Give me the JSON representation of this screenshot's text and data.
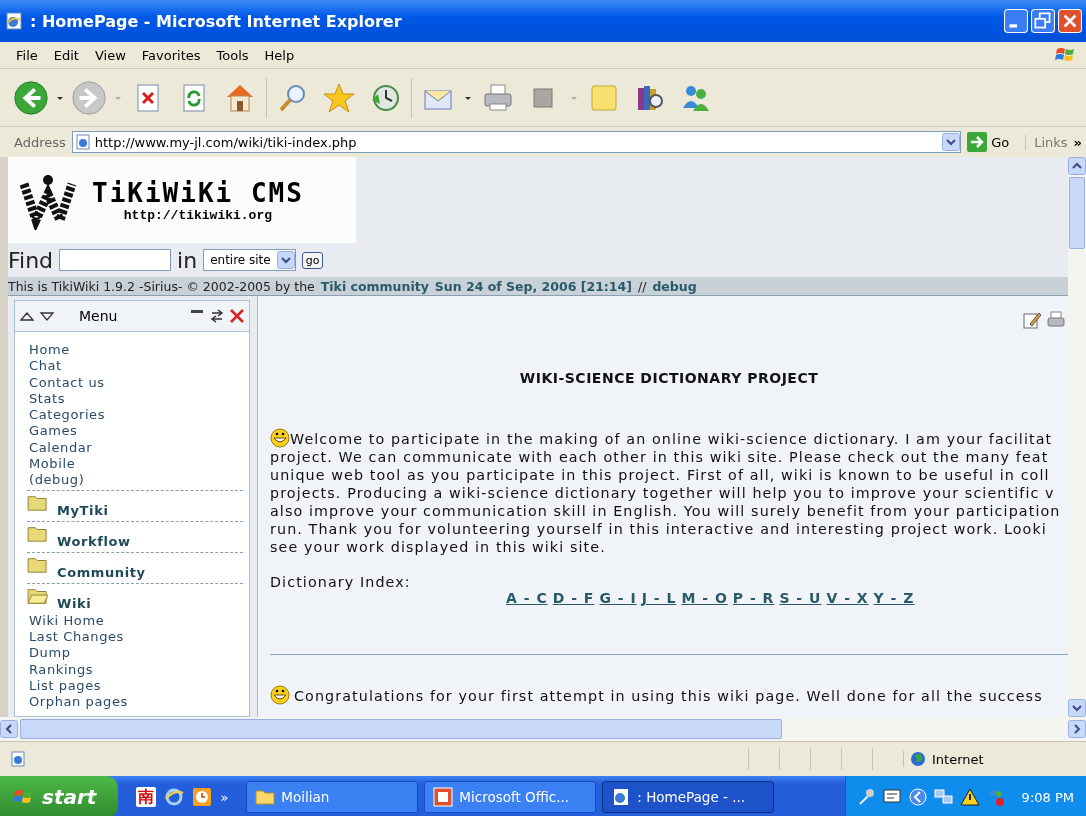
{
  "window": {
    "title": ": HomePage - Microsoft Internet Explorer"
  },
  "menu_bar": [
    "File",
    "Edit",
    "View",
    "Favorites",
    "Tools",
    "Help"
  ],
  "address_bar": {
    "label": "Address",
    "url": "http://www.my-jl.com/wiki/tiki-index.php",
    "go": "Go",
    "links": "Links",
    "more": "»"
  },
  "site": {
    "logo_title": "TiKiWiKi CMS",
    "logo_url": "http://tikiwiki.org",
    "find": {
      "label": "Find",
      "in_label": "in",
      "scope": "entire site",
      "go": "go"
    },
    "info_bar": {
      "text": "This is TikiWiki 1.9.2 -Sirius- © 2002-2005 by the",
      "link": "Tiki community",
      "date": "Sun 24 of Sep, 2006 [21:14]",
      "separator": "//",
      "debug": "debug"
    }
  },
  "menu": {
    "title": "Menu",
    "items": [
      {
        "kind": "link",
        "label": "Home"
      },
      {
        "kind": "link",
        "label": "Chat"
      },
      {
        "kind": "link",
        "label": "Contact us"
      },
      {
        "kind": "link",
        "label": "Stats"
      },
      {
        "kind": "link",
        "label": "Categories"
      },
      {
        "kind": "link",
        "label": "Games"
      },
      {
        "kind": "link",
        "label": "Calendar"
      },
      {
        "kind": "link",
        "label": "Mobile"
      },
      {
        "kind": "link",
        "label": "(debug)"
      },
      {
        "kind": "section",
        "label": "MyTiki",
        "expanded": false
      },
      {
        "kind": "section",
        "label": "Workflow",
        "expanded": false
      },
      {
        "kind": "section",
        "label": "Community",
        "expanded": false
      },
      {
        "kind": "section",
        "label": "Wiki",
        "expanded": true,
        "children": [
          {
            "label": "Wiki Home"
          },
          {
            "label": "Last Changes"
          },
          {
            "label": "Dump"
          },
          {
            "label": "Rankings"
          },
          {
            "label": "List pages"
          },
          {
            "label": "Orphan pages"
          }
        ]
      }
    ]
  },
  "article": {
    "heading": "WIKI-SCIENCE DICTIONARY PROJECT",
    "intro_lines": [
      "Welcome to participate in the making of an online wiki-science dictionary. I am your facilitat",
      "project. We can communicate with each other in this wiki site. Please check out the many feat",
      "unique web tool as you participate in this project. First of all, wiki is known to be useful in coll",
      "projects. Producing a wiki-science dictionary together will help you to improve your scientific v",
      "also improve your communication skill in English. You will surely benefit from your participation",
      "run. Thank you for volunteering yourself in this interactive and interesting project work. Looki",
      "see your work displayed in this wiki site."
    ],
    "index_label": "Dictionary Index:",
    "index_links": [
      "A - C",
      "D - F",
      "G - I",
      "J - L",
      "M - O",
      "P - R",
      "S - U",
      "V - X",
      "Y - Z"
    ],
    "second_line": "Congratulations for your first attempt in using this wiki page. Well done for all the success"
  },
  "status_bar": {
    "zone": "Internet"
  },
  "taskbar": {
    "start": "start",
    "quick_launch_glyph": "南",
    "more": "»",
    "tasks": [
      {
        "label": "Moilian",
        "kind": "folder",
        "selected": false
      },
      {
        "label": "Microsoft Offic...",
        "kind": "office",
        "selected": false
      },
      {
        "label": ": HomePage - ...",
        "kind": "browser",
        "selected": true
      }
    ],
    "clock": "9:08 PM"
  }
}
